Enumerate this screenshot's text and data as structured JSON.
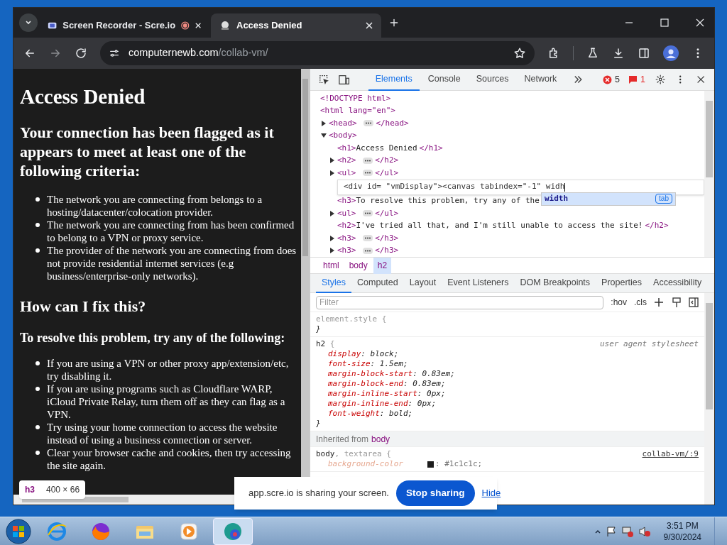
{
  "browser": {
    "tabs": [
      {
        "title": "Screen Recorder - Scre.io",
        "selected": false,
        "recording": true
      },
      {
        "title": "Access Denied",
        "selected": true,
        "recording": false
      }
    ],
    "url_host": "computernewb.com",
    "url_path": "/collab-vm/"
  },
  "page": {
    "h1": "Access Denied",
    "h2": "Your connection has been flagged as it appears to meet at least one of the following criteria:",
    "criteria": [
      "The network you are connecting from belongs to a hosting/datacenter/colocation provider.",
      "The network you are connecting from has been confirmed to belong to a VPN or proxy service.",
      "The provider of the network you are connecting from does not provide residential internet services (e.g business/enterprise-only networks)."
    ],
    "h2b": "How can I fix this?",
    "h3": "To resolve this problem, try any of the following:",
    "fixes": [
      "If you are using a VPN or other proxy app/extension/etc, try disabling it.",
      "If you are using programs such as Cloudflare WARP, iCloud Private Relay, turn them off as they can flag as a VPN.",
      "Try using your home connection to access the website instead of using a business connection or server.",
      "Clear your browser cache and cookies, then try accessing the site again."
    ],
    "tooltip": {
      "tag": "h3",
      "size": "400 × 66"
    }
  },
  "devtools": {
    "tabs": [
      {
        "label": "Elements",
        "selected": true
      },
      {
        "label": "Console",
        "selected": false
      },
      {
        "label": "Sources",
        "selected": false
      },
      {
        "label": "Network",
        "selected": false
      }
    ],
    "errors": "5",
    "issues": "1",
    "dom": [
      {
        "kind": "element",
        "open": "<!DOCTYPE html>"
      },
      {
        "kind": "element",
        "open": "<html lang=\"en\">",
        "children": [
          {
            "kind": "element",
            "open": "<head>",
            "close": "</head>",
            "expanded": false
          },
          {
            "kind": "element",
            "open": "<body>",
            "expanded": true,
            "children": [
              {
                "kind": "element",
                "open": "<h1>",
                "text": "Access Denied",
                "close": "</h1>"
              },
              {
                "kind": "element",
                "open": "<h2>",
                "close": "</h2>",
                "expanded": false
              },
              {
                "kind": "element",
                "open": "<ul>",
                "close": "</ul>",
                "expanded": false
              },
              {
                "kind": "editor",
                "text": "<div id= \"vmDisplay\"><canvas tabindex=\"-1\" widh",
                "suggestion": "width",
                "hint": "tab"
              },
              {
                "kind": "element",
                "open": "<h3>",
                "text": "To resolve this problem, try any of the"
              },
              {
                "kind": "element",
                "open": "<ul>",
                "close": "</ul>",
                "expanded": false
              },
              {
                "kind": "element",
                "open": "<h2>",
                "text": "I've tried all that, and I'm still unable to access the site!",
                "close": "</h2>"
              },
              {
                "kind": "element",
                "open": "<h3>",
                "close": "</h3>",
                "expanded": false
              },
              {
                "kind": "element",
                "open": "<h3>",
                "close": "</h3>",
                "expanded": false
              }
            ]
          }
        ]
      }
    ],
    "breadcrumbs": [
      {
        "label": "html",
        "selected": false
      },
      {
        "label": "body",
        "selected": false
      },
      {
        "label": "h2",
        "selected": true
      }
    ],
    "panel_tabs": [
      {
        "label": "Styles",
        "selected": true
      },
      {
        "label": "Computed",
        "selected": false
      },
      {
        "label": "Layout",
        "selected": false
      },
      {
        "label": "Event Listeners",
        "selected": false
      },
      {
        "label": "DOM Breakpoints",
        "selected": false
      },
      {
        "label": "Properties",
        "selected": false
      },
      {
        "label": "Accessibility",
        "selected": false
      }
    ],
    "filter_placeholder": "Filter",
    "hov": ":hov",
    "cls": ".cls",
    "rules": [
      {
        "kind": "rule",
        "selector": "element.style",
        "selector_rest": " {",
        "muted": true,
        "close": "}"
      },
      {
        "kind": "rule",
        "selector": "h2",
        "selector_rest": " {",
        "muted": false,
        "source": "user agent stylesheet",
        "close": "}",
        "declarations": [
          {
            "property": "display",
            "value": ": block;"
          },
          {
            "property": "font-size",
            "value": ": 1.5em;"
          },
          {
            "property": "margin-block-start",
            "value": ": 0.83em;"
          },
          {
            "property": "margin-block-end",
            "value": ": 0.83em;"
          },
          {
            "property": "margin-inline-start",
            "value": ": 0px;"
          },
          {
            "property": "margin-inline-end",
            "value": ": 0px;"
          },
          {
            "property": "font-weight",
            "value": ": bold;"
          }
        ]
      },
      {
        "kind": "inherited",
        "label": "Inherited from",
        "from": "body"
      },
      {
        "kind": "rule",
        "selector": "body",
        "selector_rest": ", textarea {",
        "muted": false,
        "source": "collab-vm/:9",
        "declarations": [
          {
            "property": "background-color",
            "value": ": #1c1c1c;",
            "color": "#1c1c1c"
          }
        ]
      }
    ]
  },
  "share_bar": {
    "message": "app.scre.io is sharing your screen.",
    "stop": "Stop sharing",
    "hide": "Hide"
  },
  "taskbar": {
    "time": "3:51 PM",
    "date": "9/30/2024"
  }
}
